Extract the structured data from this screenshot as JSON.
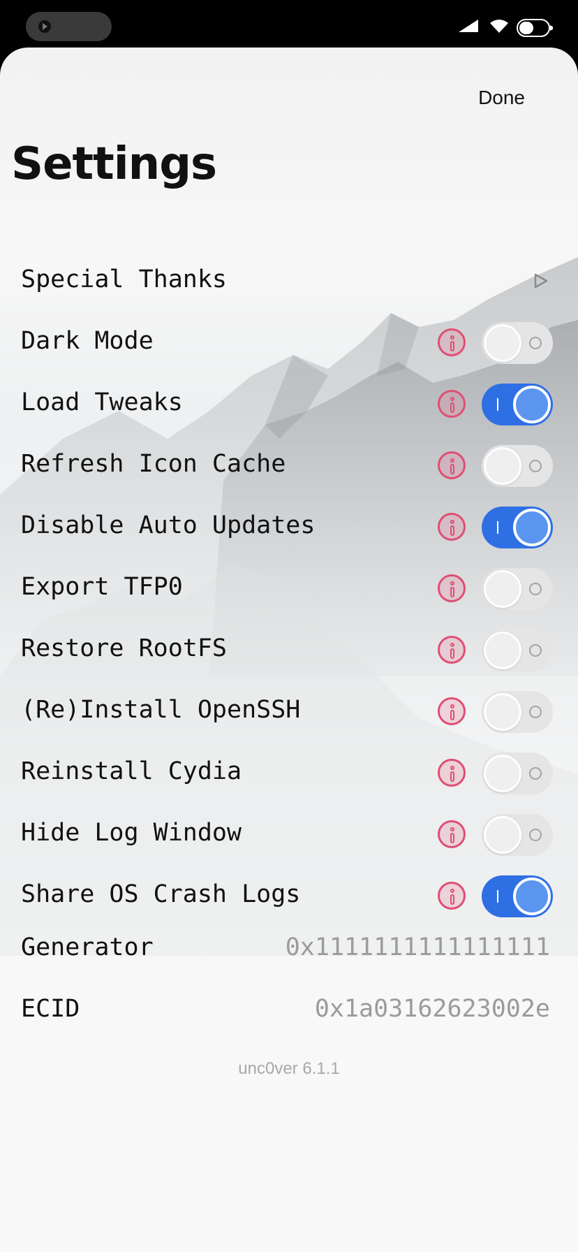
{
  "header": {
    "done_label": "Done",
    "title": "Settings"
  },
  "status_bar": {
    "icons": [
      "cellular-signal-icon",
      "wifi-icon",
      "battery-icon"
    ]
  },
  "settings": {
    "special_thanks": "Special Thanks",
    "toggles": [
      {
        "label": "Dark Mode",
        "on": false
      },
      {
        "label": "Load Tweaks",
        "on": true
      },
      {
        "label": "Refresh Icon Cache",
        "on": false
      },
      {
        "label": "Disable Auto Updates",
        "on": true
      },
      {
        "label": "Export TFP0",
        "on": false
      },
      {
        "label": "Restore RootFS",
        "on": false
      },
      {
        "label": "(Re)Install OpenSSH",
        "on": false
      },
      {
        "label": "Reinstall Cydia",
        "on": false
      },
      {
        "label": "Hide Log Window",
        "on": false
      },
      {
        "label": "Share OS Crash Logs",
        "on": true
      }
    ],
    "generator": {
      "label": "Generator",
      "value": "0x1111111111111111"
    },
    "ecid": {
      "label": "ECID",
      "value": "0x1a03162623002e"
    }
  },
  "footer": {
    "version": "unc0ver 6.1.1"
  },
  "colors": {
    "toggle_on": "#2f6fe4",
    "toggle_off": "#e5e5e5",
    "info_accent": "#df4f73",
    "value_gray": "#9b9b9b"
  }
}
